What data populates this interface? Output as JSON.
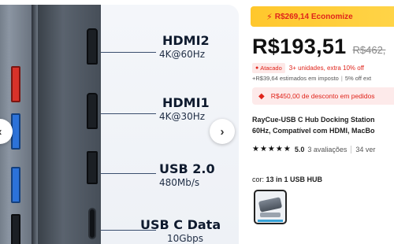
{
  "gallery": {
    "specs": [
      {
        "title": "HDMI2",
        "sub": "4K@60Hz"
      },
      {
        "title": "HDMI1",
        "sub": "4K@30Hz"
      },
      {
        "title": "USB 2.0",
        "sub": "480Mb/s"
      },
      {
        "title": "USB C Data",
        "sub": "10Gbps"
      }
    ],
    "next_icon": "chevron-right-icon",
    "prev_icon": "chevron-left-icon"
  },
  "flash": {
    "icon": "lightning-icon",
    "text": "R$269,14 Economize"
  },
  "price": {
    "current": "R$193,51",
    "original": "R$462,"
  },
  "wholesale": {
    "badge": "Atacado",
    "text": "3+ unidades, extra 10% off"
  },
  "tax": {
    "text": "+R$39,64 estimados em imposto",
    "extra": "5% off ext"
  },
  "discount": {
    "text": "R$450,00 de desconto em pedidos"
  },
  "product": {
    "title_line1": "RayCue-USB C Hub Docking Station",
    "title_line2": "60Hz, Compatível com HDMI, MacBo"
  },
  "rating": {
    "stars": "★★★★★",
    "value": "5.0",
    "reviews": "3 avaliações",
    "sold": "34 ver"
  },
  "variant": {
    "label": "cor:",
    "value": "13 in 1 USB HUB"
  },
  "colors": {
    "accent_red": "#e0241b",
    "flash_yellow": "#ffc72c",
    "spec_text": "#0e1a2e"
  }
}
